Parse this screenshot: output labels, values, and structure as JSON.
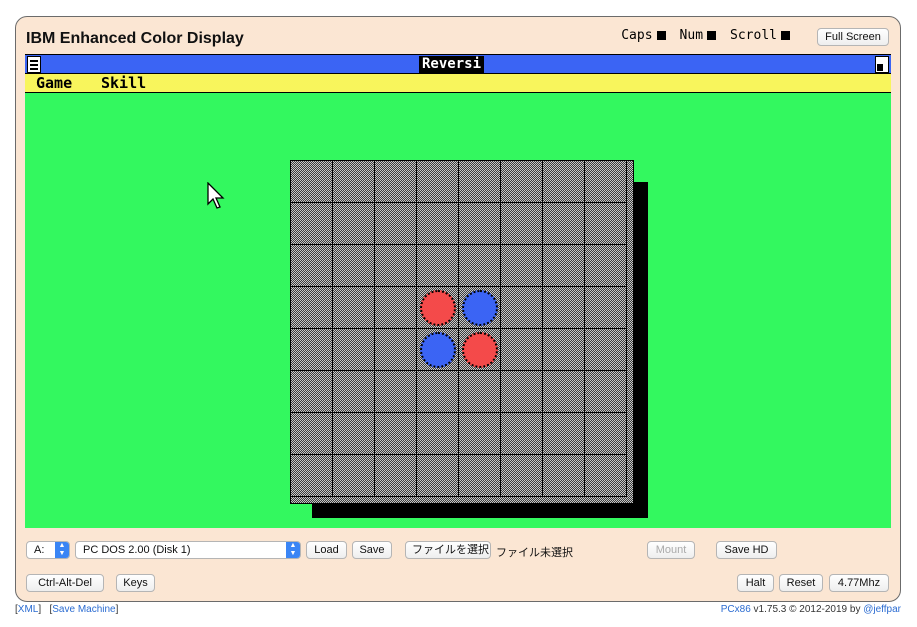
{
  "frame": {
    "title": "IBM Enhanced Color Display",
    "fullscreen_label": "Full Screen"
  },
  "indicators": [
    {
      "label": "Caps"
    },
    {
      "label": "Num"
    },
    {
      "label": "Scroll"
    }
  ],
  "window": {
    "title": "Reversi",
    "menu": [
      "Game",
      "Skill"
    ]
  },
  "board": {
    "rows": 8,
    "cols": 8,
    "pieces": [
      {
        "row": 3,
        "col": 3,
        "color": "#f44a4a"
      },
      {
        "row": 3,
        "col": 4,
        "color": "#3b64f4"
      },
      {
        "row": 4,
        "col": 3,
        "color": "#3b64f4"
      },
      {
        "row": 4,
        "col": 4,
        "color": "#f44a4a"
      }
    ]
  },
  "controls": {
    "drive": "A:",
    "disk": "PC DOS 2.00 (Disk 1)",
    "load": "Load",
    "save": "Save",
    "choose_file": "ファイルを選択",
    "no_file": "ファイル未選択",
    "mount": "Mount",
    "save_hd": "Save HD",
    "ctrl_alt_del": "Ctrl-Alt-Del",
    "keys": "Keys",
    "halt": "Halt",
    "reset": "Reset",
    "speed": "4.77Mhz"
  },
  "footer": {
    "xml": "XML",
    "save_machine": "Save Machine",
    "product": "PCx86",
    "version": " v1.75.3 © 2012-2019 by ",
    "author": "@jeffpar"
  },
  "colors": {
    "desktop": "#33f85f",
    "titlebar": "#3b64f4",
    "menubar": "#f8f55c",
    "frame": "#fbe6d3"
  }
}
